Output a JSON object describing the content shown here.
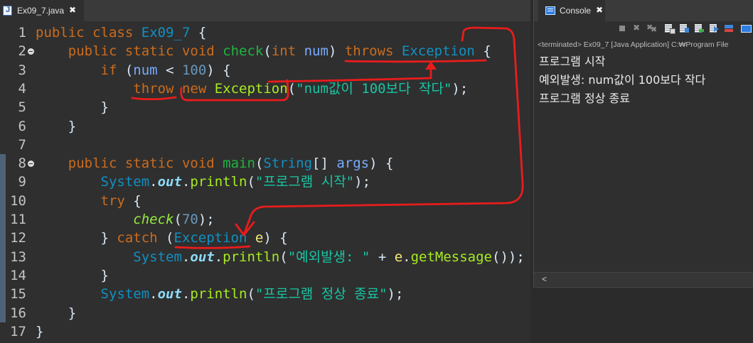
{
  "editor": {
    "tab": {
      "label": "Ex09_7.java",
      "icon": "java-file-icon",
      "close_icon": "close-icon"
    },
    "lines": [
      {
        "number": "1",
        "tokens": [
          {
            "text": "public",
            "color": "#cc6c1d"
          },
          {
            "text": " "
          },
          {
            "text": "class",
            "color": "#cc6c1d"
          },
          {
            "text": " "
          },
          {
            "text": "Ex09_7",
            "color": "#1290c3"
          },
          {
            "text": " {"
          }
        ]
      },
      {
        "number": "2",
        "foldable": true,
        "tokens": [
          {
            "text": "    "
          },
          {
            "text": "public",
            "color": "#cc6c1d"
          },
          {
            "text": " "
          },
          {
            "text": "static",
            "color": "#cc6c1d"
          },
          {
            "text": " "
          },
          {
            "text": "void",
            "color": "#cc6c1d"
          },
          {
            "text": " "
          },
          {
            "text": "check",
            "color": "#1eb540"
          },
          {
            "text": "("
          },
          {
            "text": "int",
            "color": "#cc6c1d"
          },
          {
            "text": " "
          },
          {
            "text": "num",
            "color": "#79abff"
          },
          {
            "text": ") "
          },
          {
            "text": "throws",
            "color": "#cc6c1d"
          },
          {
            "text": " "
          },
          {
            "text": "Exception",
            "color": "#1290c3"
          },
          {
            "text": " {"
          }
        ]
      },
      {
        "number": "3",
        "tokens": [
          {
            "text": "        "
          },
          {
            "text": "if",
            "color": "#cc6c1d"
          },
          {
            "text": " ("
          },
          {
            "text": "num",
            "color": "#79abff"
          },
          {
            "text": " < "
          },
          {
            "text": "100",
            "color": "#6897bb"
          },
          {
            "text": ") {"
          }
        ]
      },
      {
        "number": "4",
        "tokens": [
          {
            "text": "            "
          },
          {
            "text": "throw",
            "color": "#cc6c1d"
          },
          {
            "text": " "
          },
          {
            "text": "new",
            "color": "#cc6c1d"
          },
          {
            "text": " "
          },
          {
            "text": "Exception",
            "color": "#a7ec21"
          },
          {
            "text": "("
          },
          {
            "text": "\"num값이 100보다 작다\"",
            "color": "#17c6a3"
          },
          {
            "text": ");"
          }
        ]
      },
      {
        "number": "5",
        "tokens": [
          {
            "text": "        }"
          }
        ]
      },
      {
        "number": "6",
        "tokens": [
          {
            "text": "    }"
          }
        ]
      },
      {
        "number": "7",
        "tokens": []
      },
      {
        "number": "8",
        "foldable": true,
        "tokens": [
          {
            "text": "    "
          },
          {
            "text": "public",
            "color": "#cc6c1d"
          },
          {
            "text": " "
          },
          {
            "text": "static",
            "color": "#cc6c1d"
          },
          {
            "text": " "
          },
          {
            "text": "void",
            "color": "#cc6c1d"
          },
          {
            "text": " "
          },
          {
            "text": "main",
            "color": "#1eb540"
          },
          {
            "text": "("
          },
          {
            "text": "String",
            "color": "#1290c3"
          },
          {
            "text": "[] "
          },
          {
            "text": "args",
            "color": "#79abff"
          },
          {
            "text": ") {"
          }
        ]
      },
      {
        "number": "9",
        "tokens": [
          {
            "text": "        "
          },
          {
            "text": "System",
            "color": "#1290c3"
          },
          {
            "text": "."
          },
          {
            "text": "out",
            "color": "#8ddaf8",
            "bold": true,
            "italic": true
          },
          {
            "text": "."
          },
          {
            "text": "println",
            "color": "#a7ec21"
          },
          {
            "text": "("
          },
          {
            "text": "\"프로그램 시작\"",
            "color": "#17c6a3"
          },
          {
            "text": ");"
          }
        ]
      },
      {
        "number": "10",
        "tokens": [
          {
            "text": "        "
          },
          {
            "text": "try",
            "color": "#cc6c1d"
          },
          {
            "text": " {"
          }
        ]
      },
      {
        "number": "11",
        "tokens": [
          {
            "text": "            "
          },
          {
            "text": "check",
            "color": "#96ec3f",
            "italic": true
          },
          {
            "text": "("
          },
          {
            "text": "70",
            "color": "#6897bb"
          },
          {
            "text": ");"
          }
        ]
      },
      {
        "number": "12",
        "tokens": [
          {
            "text": "        } "
          },
          {
            "text": "catch",
            "color": "#cc6c1d"
          },
          {
            "text": " ("
          },
          {
            "text": "Exception",
            "color": "#1290c3"
          },
          {
            "text": " "
          },
          {
            "text": "e",
            "color": "#f3ec79"
          },
          {
            "text": ") {"
          }
        ]
      },
      {
        "number": "13",
        "tokens": [
          {
            "text": "            "
          },
          {
            "text": "System",
            "color": "#1290c3"
          },
          {
            "text": "."
          },
          {
            "text": "out",
            "color": "#8ddaf8",
            "bold": true,
            "italic": true
          },
          {
            "text": "."
          },
          {
            "text": "println",
            "color": "#a7ec21"
          },
          {
            "text": "("
          },
          {
            "text": "\"예외발생: \"",
            "color": "#17c6a3"
          },
          {
            "text": " + "
          },
          {
            "text": "e",
            "color": "#f3ec79"
          },
          {
            "text": "."
          },
          {
            "text": "getMessage",
            "color": "#a7ec21"
          },
          {
            "text": "());"
          }
        ]
      },
      {
        "number": "14",
        "tokens": [
          {
            "text": "        }"
          }
        ]
      },
      {
        "number": "15",
        "tokens": [
          {
            "text": "        "
          },
          {
            "text": "System",
            "color": "#1290c3"
          },
          {
            "text": "."
          },
          {
            "text": "out",
            "color": "#8ddaf8",
            "bold": true,
            "italic": true
          },
          {
            "text": "."
          },
          {
            "text": "println",
            "color": "#a7ec21"
          },
          {
            "text": "("
          },
          {
            "text": "\"프로그램 정상 종료\"",
            "color": "#17c6a3"
          },
          {
            "text": ");"
          }
        ]
      },
      {
        "number": "16",
        "tokens": [
          {
            "text": "    }"
          }
        ]
      },
      {
        "number": "17",
        "tokens": [
          {
            "text": "}"
          }
        ]
      }
    ]
  },
  "console": {
    "tab": {
      "label": "Console",
      "icon": "console-icon",
      "close_icon": "close-icon"
    },
    "toolbar": [
      "terminate-icon",
      "remove-launch-icon",
      "remove-all-terminated-icon",
      "clear-console-icon",
      "scroll-lock-icon",
      "word-wrap-icon",
      "show-console-on-output-icon",
      "pin-console-icon",
      "display-selected-console-icon"
    ],
    "status": "<terminated> Ex09_7 [Java Application] C:₩Program File",
    "output": [
      "프로그램 시작",
      "예외발생: num값이 100보다 작다",
      "프로그램 정상 종료"
    ],
    "scroll_left": "<"
  },
  "annotation_color": "#ea1c1c"
}
